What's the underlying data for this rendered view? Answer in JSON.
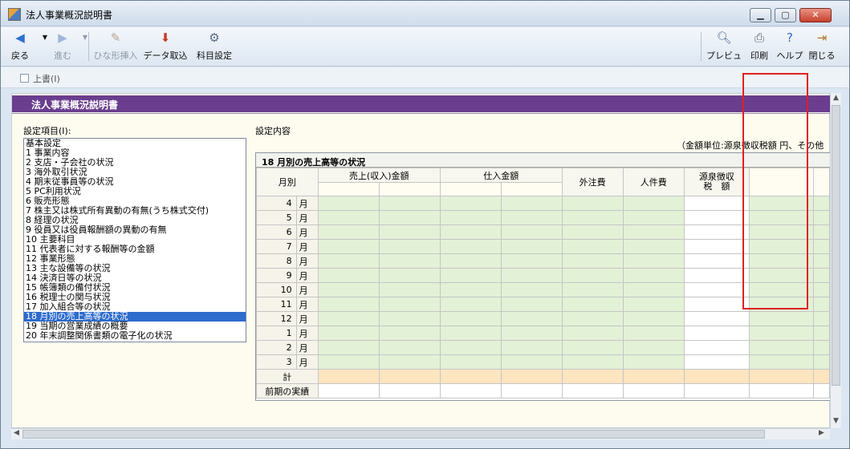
{
  "window": {
    "title": "法人事業概況説明書"
  },
  "toolbar": {
    "back": "戻る",
    "forward": "進む",
    "template_insert": "ひな形挿入",
    "data_import": "データ取込",
    "account_setting": "科目設定",
    "preview": "プレビュー",
    "print": "印刷",
    "help": "ヘルプ",
    "close": "閉じる"
  },
  "options": {
    "overwrite_label": "上書(I)"
  },
  "panel": {
    "heading": "法人事業概況説明書",
    "items_label": "設定項目(I):",
    "content_label": "設定内容",
    "unit_note": "（金額単位:源泉徴収税額 円、その他"
  },
  "items": [
    "基本設定",
    "1 事業内容",
    "2 支店・子会社の状況",
    "3 海外取引状況",
    "4 期末従事員等の状況",
    "5 PC利用状況",
    "6 販売形態",
    "7 株主又は株式所有異動の有無(うち株式交付)",
    "8 経理の状況",
    "9 役員又は役員報酬額の異動の有無",
    "10 主要科目",
    "11 代表者に対する報酬等の金額",
    "12 事業形態",
    "13 主な設備等の状況",
    "14 決済日等の状況",
    "15 帳簿類の備付状況",
    "16 税理士の関与状況",
    "17 加入組合等の状況",
    "18 月別の売上高等の状況",
    "19 当期の営業成績の概要",
    "20 年末調整関係書類の電子化の状況"
  ],
  "selected_item_index": 18,
  "grid": {
    "caption": "18 月別の売上高等の状況",
    "headers": {
      "month": "月別",
      "sales": "売上(収入)金額",
      "purchase": "仕入金額",
      "outsourcing": "外注費",
      "personnel": "人件費",
      "withholding_top": "源泉徴収",
      "withholding_bottom": "税　額"
    },
    "months": [
      "4",
      "5",
      "6",
      "7",
      "8",
      "9",
      "10",
      "11",
      "12",
      "1",
      "2",
      "3"
    ],
    "month_unit": "月",
    "total_label": "計",
    "prev_label": "前期の実績"
  }
}
